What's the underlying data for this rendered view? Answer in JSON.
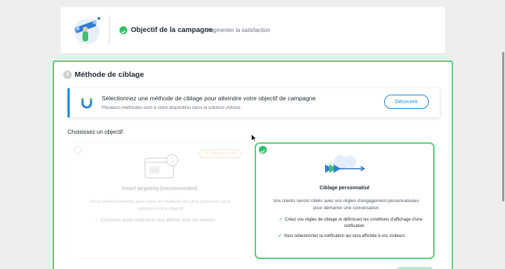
{
  "objective": {
    "title": "Objectif de la campagne",
    "value": "Augmenter la satisfaction"
  },
  "step": {
    "number": "3",
    "title": "Méthode de ciblage"
  },
  "info": {
    "title": "Sélectionnez une méthode de ciblage pour atteindre votre objectif de campagne",
    "description": "Plusieurs méthodes sont à votre disposition dans la solution iAdvize",
    "button": "Découvrir"
  },
  "choose_label": "Choisissez un objectif",
  "options": [
    {
      "tag": "Prochainement",
      "title": "Smart targeting (recommended)",
      "description": "Nous sélectionnerons pour vous les visiteurs les plus pertinents pour atteindre votre objectif",
      "bullets": [
        "Choisissez quelle notification sera affichée pour vos visiteurs"
      ],
      "selected": false
    },
    {
      "title": "Ciblage personnalisé",
      "description": "Vos clients seront ciblés avec vos règles d'engagement personnalisées pour démarrer une conversation",
      "bullets": [
        "Créez vos règles de ciblage et définissez les conditions d'affichage d'une notification",
        "Vous sélectionnez la notification qui sera affichée à vos visiteurs"
      ],
      "selected": true
    }
  ],
  "colors": {
    "success": "#2fbe62",
    "accent_blue": "#1b86d9",
    "selected_border": "#5ccc7e",
    "tag_orange": "#e0892a"
  },
  "icons": [
    "objective-illustration",
    "check-icon",
    "magnet-icon",
    "window-gear-illustration",
    "arrow-target-illustration",
    "cursor-icon"
  ]
}
